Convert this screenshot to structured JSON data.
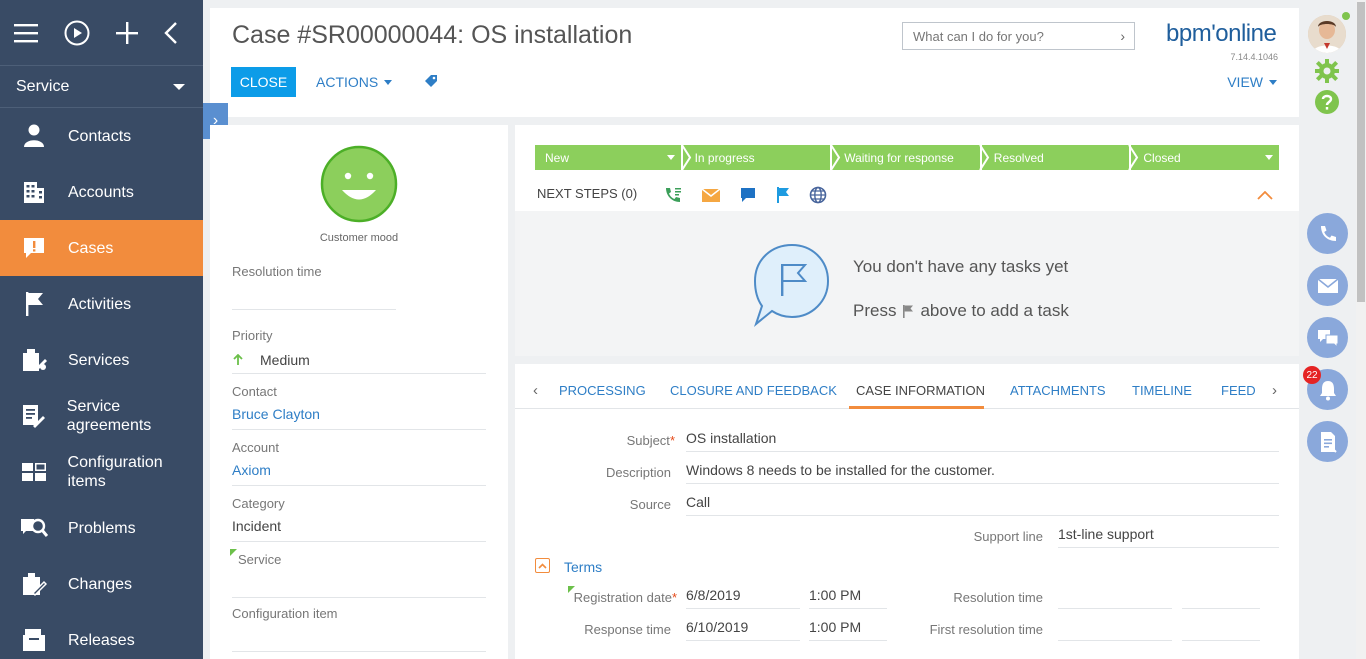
{
  "sidebar": {
    "workspace": "Service",
    "items": [
      {
        "label": "Contacts",
        "icon": "person-icon"
      },
      {
        "label": "Accounts",
        "icon": "building-icon"
      },
      {
        "label": "Cases",
        "icon": "alert-icon",
        "active": true
      },
      {
        "label": "Activities",
        "icon": "flag-icon"
      },
      {
        "label": "Services",
        "icon": "services-icon"
      },
      {
        "label": "Service agreements",
        "icon": "agreement-icon"
      },
      {
        "label": "Configuration items",
        "icon": "config-icon"
      },
      {
        "label": "Problems",
        "icon": "problem-icon"
      },
      {
        "label": "Changes",
        "icon": "changes-icon"
      },
      {
        "label": "Releases",
        "icon": "releases-icon"
      }
    ]
  },
  "header": {
    "title": "Case #SR00000044: OS installation",
    "close_label": "CLOSE",
    "actions_label": "ACTIONS",
    "search_placeholder": "What can I do for you?",
    "logo": "bpm'online",
    "version": "7.14.4.1046",
    "view_label": "VIEW"
  },
  "left_panel": {
    "mood_label": "Customer mood",
    "fields": [
      {
        "label": "Resolution time",
        "value": ""
      },
      {
        "label": "Priority",
        "value": "Medium"
      },
      {
        "label": "Contact",
        "value": "Bruce Clayton"
      },
      {
        "label": "Account",
        "value": "Axiom"
      },
      {
        "label": "Category",
        "value": "Incident"
      },
      {
        "label": "Service",
        "value": ""
      },
      {
        "label": "Configuration item",
        "value": ""
      }
    ]
  },
  "stages": [
    "New",
    "In progress",
    "Waiting for response",
    "Resolved",
    "Closed"
  ],
  "next_steps": {
    "label": "NEXT STEPS (0)",
    "empty_text": "You don't have any tasks yet",
    "press_text": "Press",
    "press_suffix": "above to add a task"
  },
  "tabs": [
    "PROCESSING",
    "CLOSURE AND FEEDBACK",
    "CASE INFORMATION",
    "ATTACHMENTS",
    "TIMELINE",
    "FEED"
  ],
  "case_info": {
    "subject_label": "Subject",
    "subject": "OS installation",
    "description_label": "Description",
    "description": "Windows 8 needs to be installed for the customer.",
    "source_label": "Source",
    "source": "Call",
    "support_line_label": "Support line",
    "support_line": "1st-line support",
    "terms_label": "Terms",
    "registration_date_label": "Registration date",
    "registration_date": "6/8/2019",
    "registration_time": "1:00 PM",
    "resolution_time_label": "Resolution time",
    "response_time_label": "Response time",
    "response_date": "6/10/2019",
    "response_time": "1:00 PM",
    "first_resolution_time_label": "First resolution time"
  },
  "notifications": {
    "count": "22"
  },
  "colors": {
    "sidebar": "#394b65",
    "accent": "#f28c3d",
    "primary": "#0c9ce8",
    "stage": "#8ccf5c",
    "link": "#2e7ec6"
  }
}
